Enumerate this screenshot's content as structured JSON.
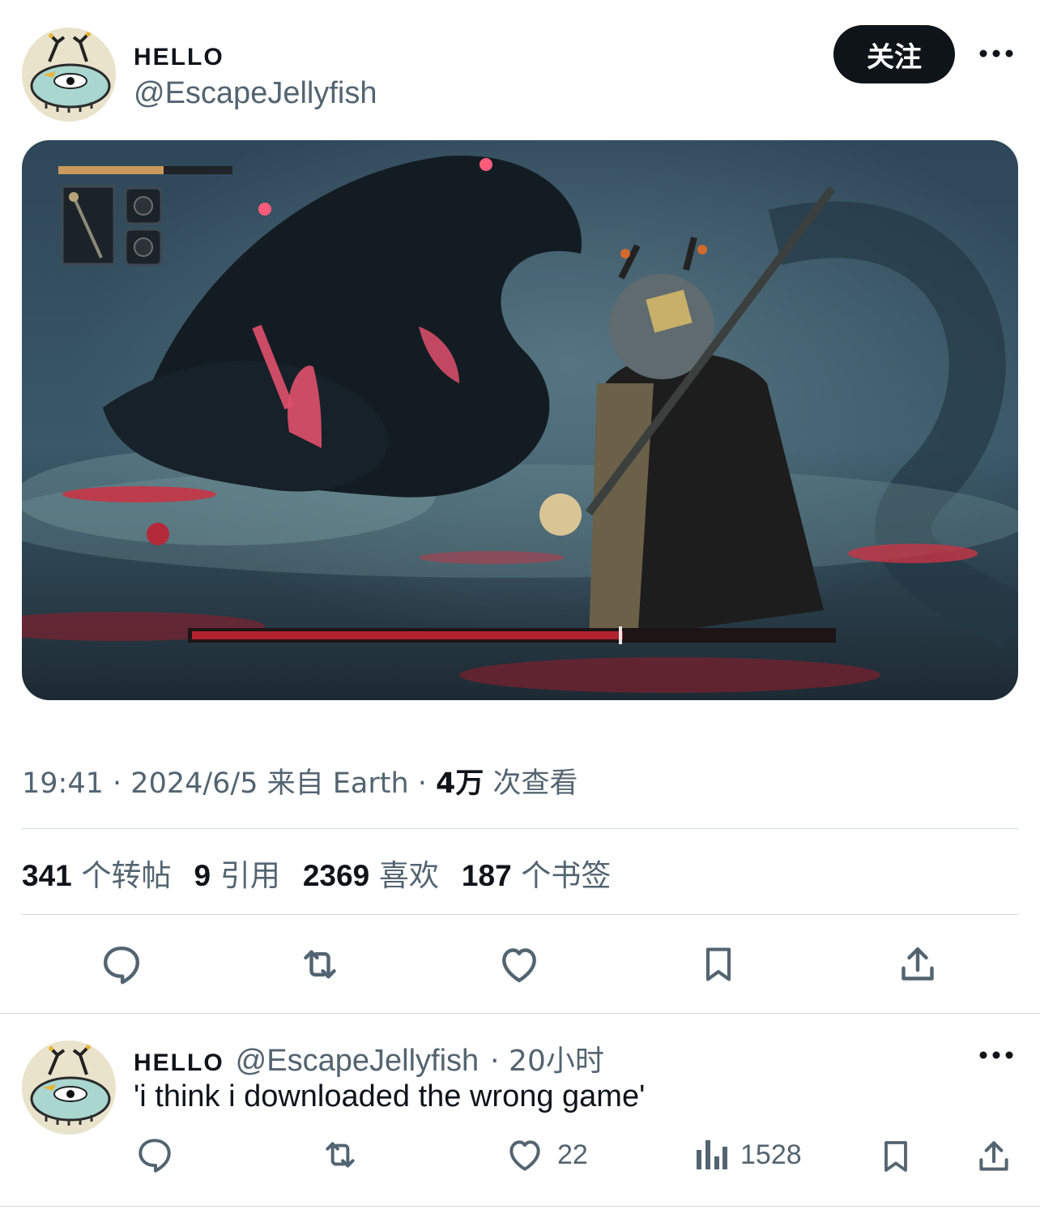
{
  "post": {
    "display_name": "HELLO",
    "handle": "@EscapeJellyfish",
    "follow_label": "关注",
    "meta": {
      "time": "19:41",
      "date": "2024/6/5",
      "source": "来自 Earth",
      "views_count": "4万",
      "views_label": "次查看",
      "separator": "·"
    },
    "stats": {
      "reposts_count": "341",
      "reposts_label": "个转帖",
      "quotes_count": "9",
      "quotes_label": "引用",
      "likes_count": "2369",
      "likes_label": "喜欢",
      "bookmarks_count": "187",
      "bookmarks_label": "个书签"
    }
  },
  "reply": {
    "display_name": "HELLO",
    "handle": "@EscapeJellyfish",
    "time": "· 20小时",
    "text": "'i think i downloaded the wrong game'",
    "likes": "22",
    "views": "1528"
  },
  "icons": {
    "reply": "reply-icon",
    "repost": "repost-icon",
    "like": "heart-icon",
    "bookmark": "bookmark-icon",
    "share": "share-icon",
    "views": "analytics-icon",
    "more": "more-icon"
  },
  "colors": {
    "text_primary": "#0f1419",
    "text_secondary": "#536471",
    "divider": "#cfd9de",
    "follow_bg": "#0f1419"
  }
}
